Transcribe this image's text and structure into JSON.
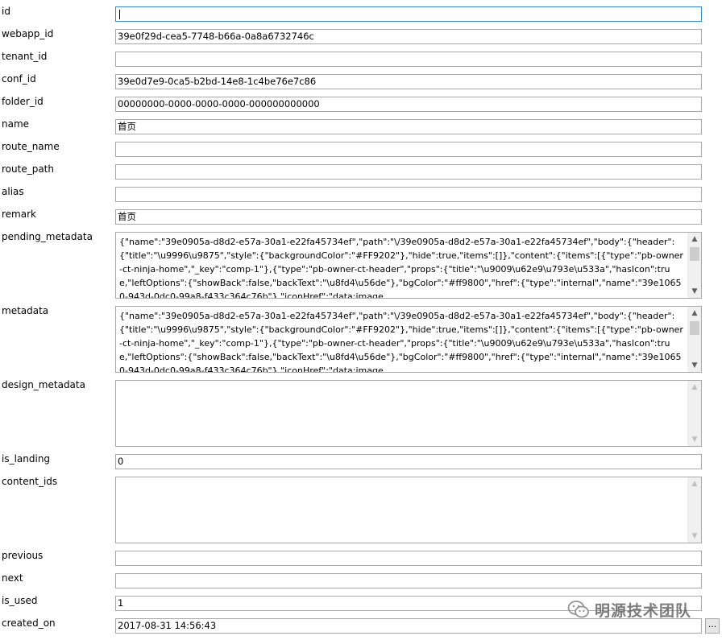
{
  "fields": {
    "id": {
      "label": "id",
      "value": ""
    },
    "webapp_id": {
      "label": "webapp_id",
      "value": "39e0f29d-cea5-7748-b66a-0a8a6732746c"
    },
    "tenant_id": {
      "label": "tenant_id",
      "value": ""
    },
    "conf_id": {
      "label": "conf_id",
      "value": "39e0d7e9-0ca5-b2bd-14e8-1c4be76e7c86"
    },
    "folder_id": {
      "label": "folder_id",
      "value": "00000000-0000-0000-0000-000000000000"
    },
    "name": {
      "label": "name",
      "value": "首页"
    },
    "route_name": {
      "label": "route_name",
      "value": ""
    },
    "route_path": {
      "label": "route_path",
      "value": ""
    },
    "alias": {
      "label": "alias",
      "value": ""
    },
    "remark": {
      "label": "remark",
      "value": "首页"
    },
    "pending_metadata": {
      "label": "pending_metadata",
      "value": "{\"name\":\"39e0905a-d8d2-e57a-30a1-e22fa45734ef\",\"path\":\"\\/39e0905a-d8d2-e57a-30a1-e22fa45734ef\",\"body\":{\"header\":{\"title\":\"\\u9996\\u9875\",\"style\":{\"backgroundColor\":\"#FF9202\"},\"hide\":true,\"items\":[]},\"content\":{\"items\":[{\"type\":\"pb-owner-ct-ninja-home\",\"_key\":\"comp-1\"},{\"type\":\"pb-owner-ct-header\",\"props\":{\"title\":\"\\u9009\\u62e9\\u793e\\u533a\",\"hasIcon\":true,\"leftOptions\":{\"showBack\":false,\"backText\":\"\\u8fd4\\u56de\"},\"bgColor\":\"#ff9800\",\"href\":{\"type\":\"internal\",\"name\":\"39e10650-943d-0dc0-99a8-f433c364c76b\"},\"iconHref\":\"data:image"
    },
    "metadata": {
      "label": "metadata",
      "value": "{\"name\":\"39e0905a-d8d2-e57a-30a1-e22fa45734ef\",\"path\":\"\\/39e0905a-d8d2-e57a-30a1-e22fa45734ef\",\"body\":{\"header\":{\"title\":\"\\u9996\\u9875\",\"style\":{\"backgroundColor\":\"#FF9202\"},\"hide\":true,\"items\":[]},\"content\":{\"items\":[{\"type\":\"pb-owner-ct-ninja-home\",\"_key\":\"comp-1\"},{\"type\":\"pb-owner-ct-header\",\"props\":{\"title\":\"\\u9009\\u62e9\\u793e\\u533a\",\"hasIcon\":true,\"leftOptions\":{\"showBack\":false,\"backText\":\"\\u8fd4\\u56de\"},\"bgColor\":\"#ff9800\",\"href\":{\"type\":\"internal\",\"name\":\"39e10650-943d-0dc0-99a8-f433c364c76b\"},\"iconHref\":\"data:image"
    },
    "design_metadata": {
      "label": "design_metadata",
      "value": ""
    },
    "is_landing": {
      "label": "is_landing",
      "value": "0"
    },
    "content_ids": {
      "label": "content_ids",
      "value": ""
    },
    "previous": {
      "label": "previous",
      "value": ""
    },
    "next": {
      "label": "next",
      "value": ""
    },
    "is_used": {
      "label": "is_used",
      "value": "1"
    },
    "created_on": {
      "label": "created_on",
      "value": "2017-08-31 14:56:43"
    }
  },
  "created_on_button": {
    "label": "..."
  },
  "watermark": {
    "text": "明源技术团队",
    "icon": "wechat-icon"
  },
  "colors": {
    "focus_border": "#3a88d6",
    "border": "#a9a9a9",
    "scrollbar": "#f0f0f0"
  }
}
